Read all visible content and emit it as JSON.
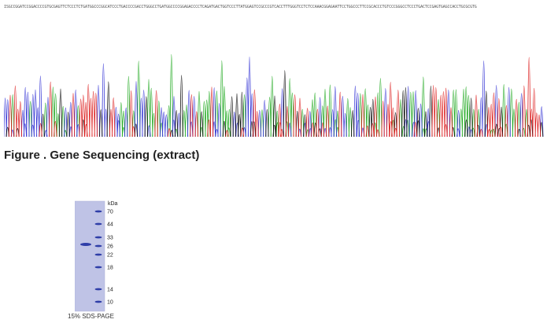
{
  "sequencing": {
    "sequence": "ISGCCGGATCCGGACCCCGTGCGAGTTCTCCCTCTGATGGCCCGGCATCCCTGACCCCGACCTGGGCCTGATGGCCCCGGAGACCCCTCAGATGACTGGTCCCTTATGGAGTCCGCCCGTCACCTTTGGGTCCTCTCCAAACGGAGAATTCCTGGCCCTTCCGCACCCTGTCCCGGGCCTCCCTGACTCCGAGTGAGCCACCTGCGCGTG",
    "caption": "Figure . Gene Sequencing (extract)",
    "trace_colors": {
      "A": "#22aa22",
      "C": "#3a3ad6",
      "G": "#111111",
      "T": "#dd2222"
    }
  },
  "gel": {
    "unit_label": "kDa",
    "markers": [
      "70",
      "44",
      "33",
      "26",
      "22",
      "18",
      "14",
      "10"
    ],
    "caption": "15% SDS-PAGE",
    "gel_color": "#bfc3e6",
    "band_color": "#2f3ea8"
  }
}
